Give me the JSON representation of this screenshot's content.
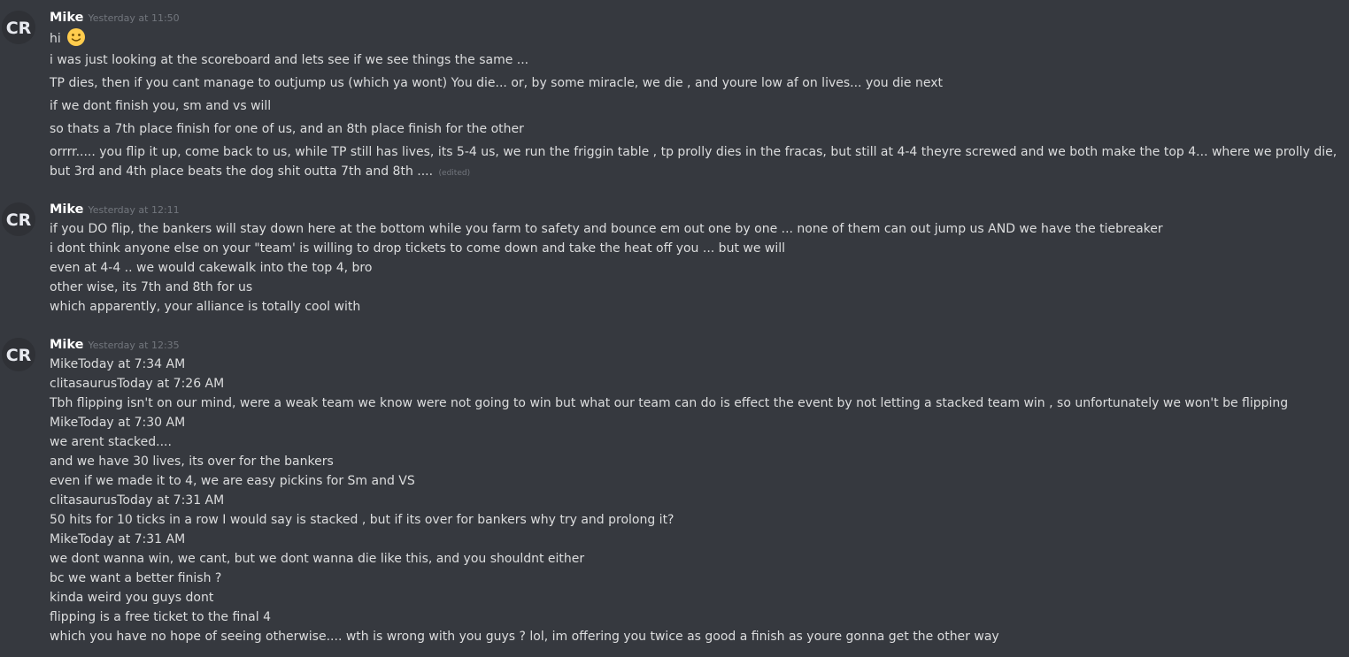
{
  "colors": {
    "background": "#36393f",
    "text": "#dcddde",
    "username": "#ffffff",
    "timestamp": "#72767d"
  },
  "messages": [
    {
      "author": "Mike",
      "time": "Yesterday at 11:50",
      "avatar_initials": "CR",
      "lines": [
        "hi",
        "i was just looking at the scoreboard and lets see if we see things the same ...",
        "TP dies, then if you cant manage to outjump us (which ya wont) You die... or, by some miracle, we die , and youre low af on lives... you die next",
        "if we dont finish you, sm and vs will",
        "so thats a 7th place finish for one of us, and an 8th place finish for the other",
        "orrrr..... you flip it up, come back to us, while TP still has lives, its 5-4 us, we run the friggin table , tp prolly dies in the fracas, but still  at 4-4 theyre screwed and we both make the top 4... where we prolly die, but 3rd and 4th place beats the dog shit outta 7th and 8th ...."
      ],
      "emoji": "slightly-smiling-face",
      "edited_label": "(edited)"
    },
    {
      "author": "Mike",
      "time": "Yesterday at 12:11",
      "avatar_initials": "CR",
      "lines": [
        "if you DO flip, the bankers will stay down here at the bottom while you farm to safety and bounce em out one by one ... none of them can out jump us AND we have the tiebreaker",
        "i dont think anyone else on your \"team' is willing to drop tickets to come down and take the heat off you ... but we will",
        "even at 4-4 .. we would cakewalk into the top 4, bro",
        "other wise, its 7th and 8th for us",
        "which apparently, your alliance is totally cool with"
      ]
    },
    {
      "author": "Mike",
      "time": "Yesterday at 12:35",
      "avatar_initials": "CR",
      "lines": [
        "MikeToday at 7:34 AM",
        "clitasaurusToday at 7:26 AM",
        "Tbh flipping isn't on our mind, were a weak team we know were not going to win but what our team can do is effect the event by not letting a stacked team win , so unfortunately we won't be flipping",
        "MikeToday at 7:30 AM",
        "we arent stacked....",
        "and we have 30 lives, its over for the bankers",
        "even if we made it to 4, we are easy pickins for Sm and VS",
        "clitasaurusToday at 7:31 AM",
        "50 hits for 10 ticks in a row I would say is stacked , but if its over for bankers why try and prolong it?",
        "MikeToday at 7:31 AM",
        "we dont wanna win, we cant, but we dont wanna die like this, and you shouldnt either",
        "bc we want a better finish ?",
        "kinda weird you guys dont",
        "flipping is a free ticket to the final 4",
        "which you have no hope of seeing otherwise.... wth is wrong with you guys ? lol, im offering you twice as good a finish as youre gonna get the other way"
      ]
    }
  ]
}
